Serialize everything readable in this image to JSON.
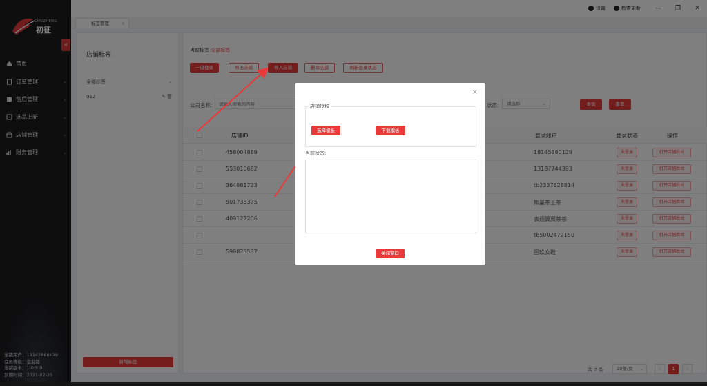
{
  "sidebar": {
    "brand_en": "CHUZHENG",
    "brand_cn": "初征",
    "items": [
      {
        "label": "首页",
        "icon": "home-icon"
      },
      {
        "label": "订单管理",
        "icon": "order-icon"
      },
      {
        "label": "售后管理",
        "icon": "aftersale-icon"
      },
      {
        "label": "选品上新",
        "icon": "products-icon"
      },
      {
        "label": "店铺管理",
        "icon": "store-icon"
      },
      {
        "label": "财务管理",
        "icon": "finance-icon"
      }
    ],
    "user": {
      "line1": "当前用户：18145880129",
      "line2": "会员等级：企业版",
      "line3": "当前版本：1.0.5.0",
      "line4": "到期时间：2021-02-25"
    }
  },
  "topbar": {
    "settings": "设置",
    "check_update": "检查更新",
    "minimize": "—",
    "restore": "❐",
    "close": "✕"
  },
  "tabs": [
    {
      "label": "标签管理"
    }
  ],
  "left_panel": {
    "title": "店铺标签",
    "all_tags": "全部标签",
    "tag_item": "012",
    "add_button": "新增标签"
  },
  "right_panel": {
    "current_tag_label": "当前标签:",
    "current_tag_value": "全部标签",
    "buttons": [
      "一键登录",
      "导出店铺",
      "导入店铺",
      "删除店铺",
      "刷新登录状态"
    ],
    "company_label": "公司名称:",
    "company_placeholder": "请输入搜索的内容",
    "status_label": "状态:",
    "status_placeholder": "请选择",
    "query": "查询",
    "reset": "重置",
    "columns": {
      "store_id": "店铺ID",
      "login_account": "登录账户",
      "login_status": "登录状态",
      "action": "操作"
    },
    "rows": [
      {
        "id": "458004889",
        "account": "18145880129",
        "status": "未登录",
        "action": "打开店铺后台"
      },
      {
        "id": "553010682",
        "account": "13187744393",
        "status": "未登录",
        "action": "打开店铺后台"
      },
      {
        "id": "364881723",
        "account": "tb2337628814",
        "status": "未登录",
        "action": "打开店铺后台"
      },
      {
        "id": "501735375",
        "account": "熊蔓茶王茶",
        "status": "未登录",
        "action": "打开店铺后台"
      },
      {
        "id": "409127206",
        "account": "表翔翼翼茶茶",
        "status": "未登录",
        "action": "打开店铺后台"
      },
      {
        "id": "",
        "account": "tb5002472150",
        "status": "未登录",
        "action": "打开店铺后台"
      },
      {
        "id": "599825537",
        "account": "困玖女鞋",
        "status": "未登录",
        "action": "打开店铺后台"
      }
    ],
    "pagination": {
      "total": "共 7 条",
      "page_size": "20条/页",
      "current": "1"
    }
  },
  "modal": {
    "close": "×",
    "auth_legend": "店铺授权",
    "select_template": "选择模板",
    "download_template": "下载模板",
    "status_legend": "当前状态:",
    "close_window": "关闭窗口"
  },
  "colors": {
    "accent": "#e83a3a",
    "sidebar_bg": "#1c1c1f"
  }
}
